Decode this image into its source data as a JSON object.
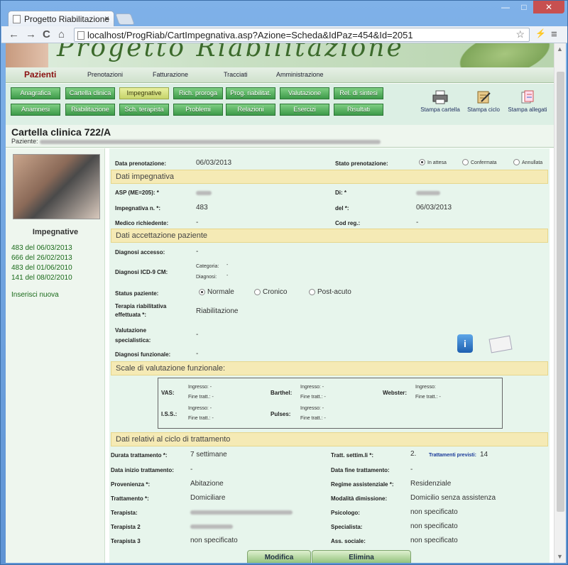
{
  "browser": {
    "tab_title": "Progetto Riabilitazione",
    "url": "localhost/ProgRiab/CartImpegnativa.asp?Azione=Scheda&IdPaz=454&Id=2051",
    "close": "×",
    "back": "←",
    "forward": "→",
    "reload": "C",
    "home": "⌂",
    "star": "☆",
    "winctl": {
      "min": "—",
      "max": "□",
      "close": "✕"
    },
    "ext": "⚡",
    "menu": "≡"
  },
  "banner": {
    "title": "Progetto Riabilitazione"
  },
  "menu": {
    "active": "Pazienti",
    "items": [
      "Prenotazioni",
      "Fatturazione",
      "Tracciati",
      "Amministrazione"
    ]
  },
  "buttons_row1": [
    "Anagrafica",
    "Cartella clinica",
    "Impegnative",
    "Rich. proroga",
    "Prog. riabilitat.",
    "Valutazione",
    "Rel. di sintesi"
  ],
  "buttons_row2": [
    "Anamnesi",
    "Riabilitazione",
    "Sch. terapista",
    "Problemi",
    "Relazioni",
    "Esercizi",
    "Risultati"
  ],
  "print": [
    "Stampa cartella",
    "Stampa ciclo",
    "Stampa allegati"
  ],
  "card": {
    "title": "Cartella clinica 722/A",
    "patient_label": "Paziente:"
  },
  "left": {
    "heading": "Impegnative",
    "links": [
      "483 del 06/03/2013",
      "666 del 26/02/2013",
      "483 del 01/06/2010",
      "141 del 08/02/2010"
    ],
    "insert": "Inserisci nuova"
  },
  "form": {
    "data_prenotazione_label": "Data prenotazione:",
    "data_prenotazione": "06/03/2013",
    "stato_label": "Stato prenotazione:",
    "stato_options": [
      "In attesa",
      "Confermata",
      "Annullata"
    ],
    "sec_impegnativa": "Dati impegnativa",
    "asp_label": "ASP (ME=205): *",
    "di_label": "Di: *",
    "imp_label": "Impegnativa n. *:",
    "imp_value": "483",
    "del_label": "del *:",
    "del_value": "06/03/2013",
    "medico_label": "Medico richiedente:",
    "medico_value": "-",
    "codreg_label": "Cod reg.:",
    "codreg_value": "-",
    "sec_accettazione": "Dati accettazione paziente",
    "diag_acc_label": "Diagnosi accesso:",
    "diag_acc_value": "-",
    "icd_label": "Diagnosi ICD-9 CM:",
    "categoria_label": "Categoria:",
    "categoria_value": "-",
    "diagnosi_label": "Diagnosi:",
    "diagnosi_value": "-",
    "status_label": "Status paziente:",
    "status_options": [
      "Normale",
      "Cronico",
      "Post-acuto"
    ],
    "terapia_label1": "Terapia riabilitativa",
    "terapia_label2": "effettuata *:",
    "terapia_value": "Riabilitazione",
    "valut_label1": "Valutazione",
    "valut_label2": "specialistica:",
    "valut_value": "-",
    "diag_funz_label": "Diagnosi funzionale:",
    "diag_funz_value": "-",
    "sec_scale": "Scale di valutazione funzionale:",
    "scales": [
      {
        "name": "VAS:"
      },
      {
        "name": "Barthel:"
      },
      {
        "name": "Webster:"
      },
      {
        "name": "I.S.S.:"
      },
      {
        "name": "Pulses:"
      }
    ],
    "ingresso_dash": "Ingresso: -",
    "fine_dash": "Fine tratt.: -",
    "ingresso": "Ingresso:",
    "sec_ciclo": "Dati relativi al ciclo di trattamento",
    "durata_label": "Durata trattamento *:",
    "durata_value": "7 settimane",
    "tratt_sett_label": "Tratt. settim.li *:",
    "tratt_sett_value": "2.",
    "tratt_prev_label": "Trattamenti previsti:",
    "tratt_prev_value": "14",
    "inizio_label": "Data inizio trattamento:",
    "inizio_value": "-",
    "fine_label": "Data fine trattamento:",
    "fine_value": "-",
    "provenienza_label": "Provenienza *:",
    "provenienza_value": "Abitazione",
    "regime_label": "Regime assistenziale *:",
    "regime_value": "Residenziale",
    "trattamento_label": "Trattamento *:",
    "trattamento_value": "Domiciliare",
    "dimissione_label": "Modalità dimissione:",
    "dimissione_value": "Domicilio senza assistenza",
    "terapista_label": "Terapista:",
    "psicologo_label": "Psicologo:",
    "psicologo_value": "non specificato",
    "terapista2_label": "Terapista 2",
    "specialista_label": "Specialista:",
    "specialista_value": "non specificato",
    "terapista3_label": "Terapista 3",
    "terapista3_value": "non specificato",
    "ass_label": "Ass. sociale:",
    "ass_value": "non specificato",
    "modifica": "Modifica",
    "elimina": "Elimina",
    "info_icon": "i"
  }
}
